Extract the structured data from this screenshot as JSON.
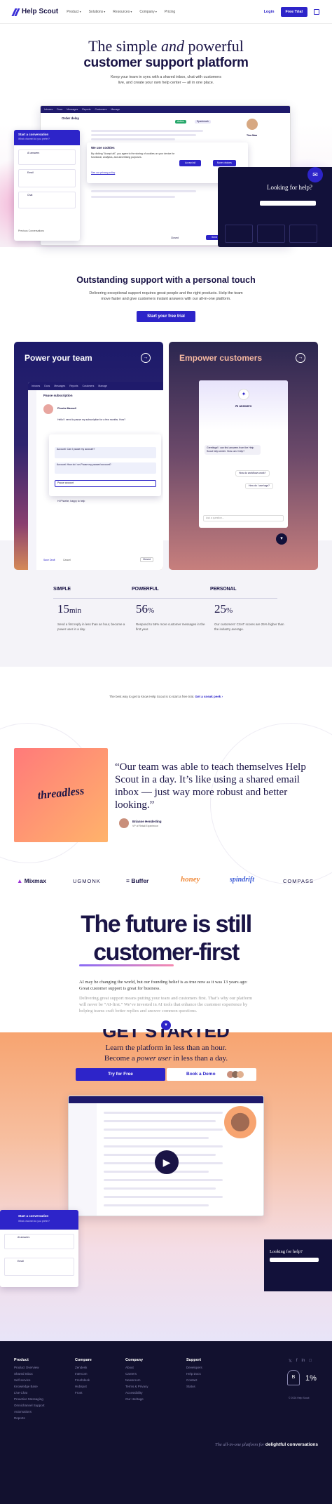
{
  "nav": {
    "brand": "Help Scout",
    "links": [
      "Product",
      "Solutions",
      "Resources",
      "Company",
      "Pricing"
    ],
    "login": "Login",
    "cta": "Free Trial"
  },
  "hero": {
    "title_pre": "The simple ",
    "title_em": "and",
    "title_post": " powerful",
    "title_bold": "customer support platform",
    "subtitle_1": "Keep your team in sync with a shared inbox, chat with customers",
    "subtitle_2": "live, and create your own help center — all in one place.",
    "mock": {
      "tabs": [
        "Inboxes",
        "Docs",
        "Messages",
        "Reports",
        "Customers",
        "Manage"
      ],
      "subject": "Order delay",
      "status": "Active",
      "assignee": "Sparkmark",
      "customer_name": "Tina Maa",
      "cookie_title": "We use cookies",
      "cookie_text": "By clicking \"Accept all\", you agree to the storing of cookies on your device for functional, analytics, and advertising purposes.",
      "cookie_link": "See our privacy policy",
      "accept_all": "Accept all",
      "more_choices": "More choices",
      "closed_label": "Closed",
      "send": "Send",
      "chat_header": "Start a conversation",
      "chat_sub": "What channel do you prefer?",
      "chat_options": [
        "AI answers",
        "Email",
        "Chat"
      ],
      "chat_previous": "Previous Conversations",
      "help_title": "Looking for help?"
    }
  },
  "support": {
    "title": "Outstanding support with a personal touch",
    "text_1": "Delivering exceptional support requires great people and the right products. Help the team",
    "text_2": "move faster and give customers instant answers with our all-in-one platform.",
    "cta": "Start your free trial"
  },
  "panels": {
    "left_title": "Power your team",
    "right_title": "Empower customers",
    "left_mock": {
      "tabs": [
        "Inboxes",
        "Docs",
        "Messages",
        "Reports",
        "Customers",
        "Manage"
      ],
      "heading": "Pause subscription",
      "name": "Phoebe Maxwell",
      "message": "Hello! I need to pause my subscription for a few months. How?",
      "ai_q1": "Account: Can I pause my account?",
      "ai_q2": "Account: How do I un-Pause my paused account?",
      "ai_input": "Pause account",
      "reply": "Hi Phoebe, happy to help",
      "save_draft": "Save Draft",
      "cancel": "Cancel",
      "closed": "Closed"
    },
    "right_mock": {
      "title": "AI answers",
      "greeting": "Greetings! I can find answers from the Help Scout help center. How can I help?",
      "q1": "How do workflows work?",
      "q2": "How do I use tags?",
      "placeholder": "Ask a question..."
    }
  },
  "stats": [
    {
      "label": "SIMPLE",
      "number": "15",
      "unit": "min",
      "desc": "Send a first reply in less than an hour, become a power user in a day."
    },
    {
      "label": "POWERFUL",
      "number": "56",
      "unit": "%",
      "desc": "Respond to 56% more customer messages in the first year."
    },
    {
      "label": "PERSONAL",
      "number": "25",
      "unit": "%",
      "desc": "Our customers' CSAT scores are 25% higher than the industry average."
    }
  ],
  "trial_line": {
    "text": "The best way to get to know Help Scout is to start a free trial.",
    "link": "Get a sneak peek ›"
  },
  "testimonial": {
    "brand": "threadless",
    "quote": "“Our team was able to teach themselves Help Scout in a day. It’s like using a shared email inbox — just way more robust and better looking.”",
    "author": "Brianne Henderling",
    "role": "VP of Retail Experience"
  },
  "logos": [
    "Mixmax",
    "UGMONK",
    "Buffer",
    "honey",
    "spindrift",
    "COMPASS"
  ],
  "future": {
    "line1": "The future is still",
    "line2": "customer-first",
    "p1": "AI may be changing the world, but our founding belief is as true now as it was 13 years ago: Great customer support is great for business.",
    "p2": "Delivering great support means putting your team and customers first. That’s why our platform will never be “AI-first.” We’ve invested in AI tools that enhance the customer experience by helping teams craft better replies and answer common questions."
  },
  "get_started": {
    "title": "GET STARTED",
    "line1": "Learn the platform in less than an hour.",
    "line2_pre": "Become a ",
    "line2_em": "power user",
    "line2_post": " in less than a day.",
    "try_free": "Try for Free",
    "book_demo": "Book a Demo",
    "chat_header": "Start a conversation",
    "chat_sub": "What channel do you prefer?",
    "chat_options": [
      "AI answers",
      "Email"
    ],
    "help_title": "Looking for help?"
  },
  "footer": {
    "columns": [
      {
        "head": "Product",
        "links": [
          "Product Overview",
          "Shared Inbox",
          "Self-service",
          "Knowledge Base",
          "Live Chat",
          "Proactive Messaging",
          "Omnichannel Support",
          "Automations",
          "Reports"
        ]
      },
      {
        "head": "Compare",
        "links": [
          "Zendesk",
          "Intercom",
          "Freshdesk",
          "Hubspot",
          "Front"
        ]
      },
      {
        "head": "Company",
        "links": [
          "About",
          "Careers",
          "Newsroom",
          "Terms & Privacy",
          "Accessibility",
          "Our Heritage"
        ]
      },
      {
        "head": "Support",
        "links": [
          "Developers",
          "Help Docs",
          "Contact",
          "Status"
        ]
      }
    ],
    "badge": "1%",
    "copyright": "© 2024 Help Scout",
    "tagline_pre": "The all-in-one platform for",
    "tagline_bold": "delightful conversations"
  },
  "colors": {
    "brand": "#2d24c9",
    "navy": "#1a1446",
    "footer": "#12112f",
    "orange": "#f7a86b"
  }
}
